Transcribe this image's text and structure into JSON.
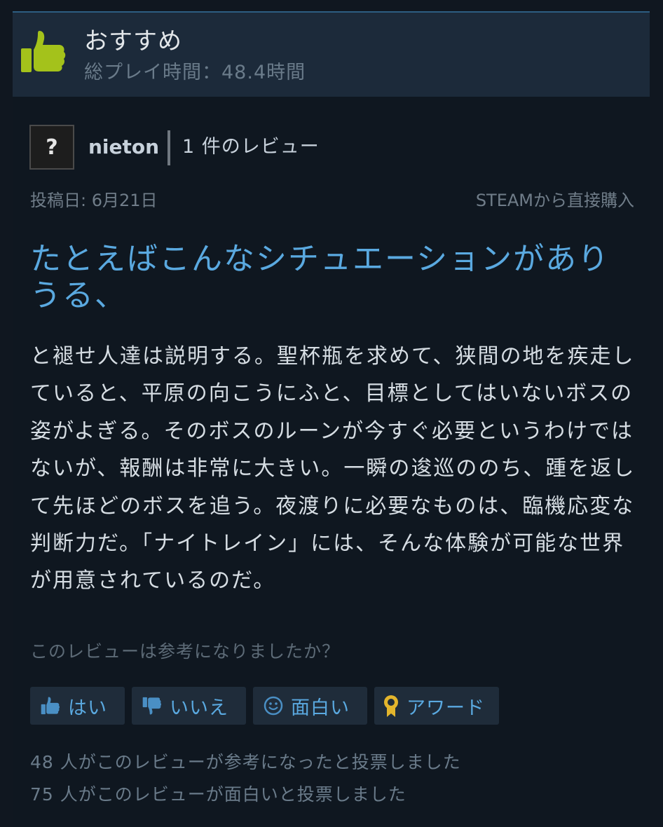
{
  "recommendation": {
    "label": "おすすめ",
    "playtime": "総プレイ時間：48.4時間",
    "icon": "thumbs-up-icon",
    "icon_color": "#a4c21b"
  },
  "author": {
    "avatar_glyph": "?",
    "name": "nieton",
    "review_count": "1 件のレビュー"
  },
  "meta": {
    "posted": "投稿日: 6月21日",
    "purchase": "STEAMから直接購入"
  },
  "review": {
    "title": "たとえばこんなシチュエーションがありうる、",
    "body": "と褪せ人達は説明する。聖杯瓶を求めて、狭間の地を疾走していると、平原の向こうにふと、目標としてはいないボスの姿がよぎる。そのボスのルーンが今すぐ必要というわけではないが、報酬は非常に大きい。一瞬の逡巡ののち、踵を返して先ほどのボスを追う。夜渡りに必要なものは、臨機応変な判断力だ。「ナイトレイン」には、そんな体験が可能な世界が用意されているのだ。"
  },
  "helpful": {
    "question": "このレビューは参考になりましたか？",
    "buttons": {
      "yes": "はい",
      "no": "いいえ",
      "funny": "面白い",
      "award": "アワード"
    },
    "stats": {
      "helpful": "48 人がこのレビューが参考になったと投票しました",
      "funny": "75 人がこのレビューが面白いと投票しました"
    }
  },
  "colors": {
    "background": "#0f1720",
    "header_bg": "#1c2a3a",
    "title_blue": "#5aa9e0",
    "button_bg": "#1f2c3a",
    "award_gold": "#e3b52c"
  }
}
